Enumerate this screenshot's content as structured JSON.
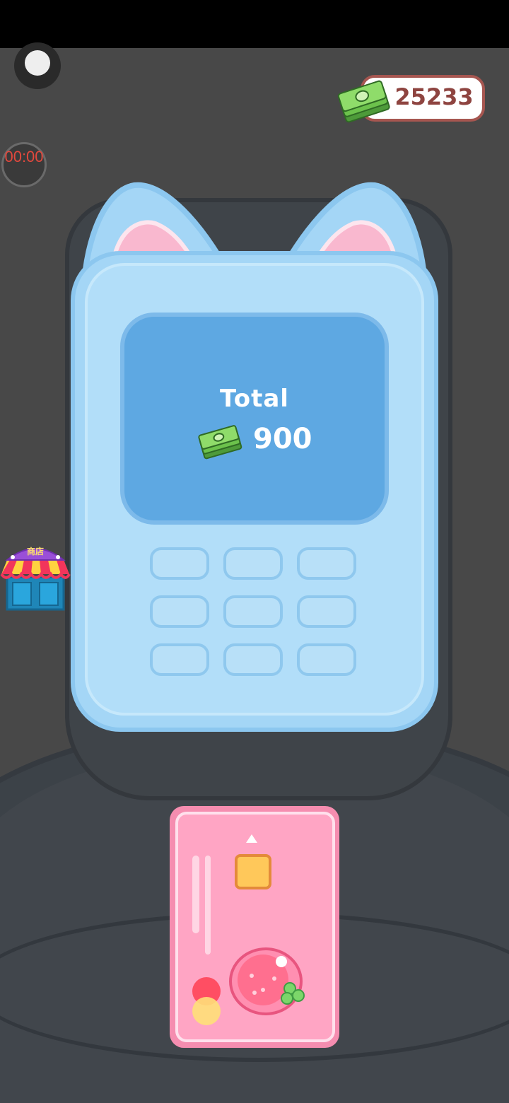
{
  "hud": {
    "timer": "00:00",
    "money": "25233"
  },
  "terminal": {
    "screen_title": "Total",
    "amount": "900",
    "keypad_rows": 3,
    "keypad_cols": 3
  },
  "shop": {
    "sign": "商店"
  },
  "colors": {
    "background": "#484848",
    "terminal_blue": "#a4d6f6",
    "screen_blue": "#5ea8e2",
    "card_pink": "#ffa5c4",
    "money_text": "#8e4440",
    "timer_text": "#e2483d"
  },
  "icons": [
    "record-icon",
    "cash-stack-icon",
    "shop-icon",
    "strawberry-icon",
    "card-chip-icon"
  ]
}
